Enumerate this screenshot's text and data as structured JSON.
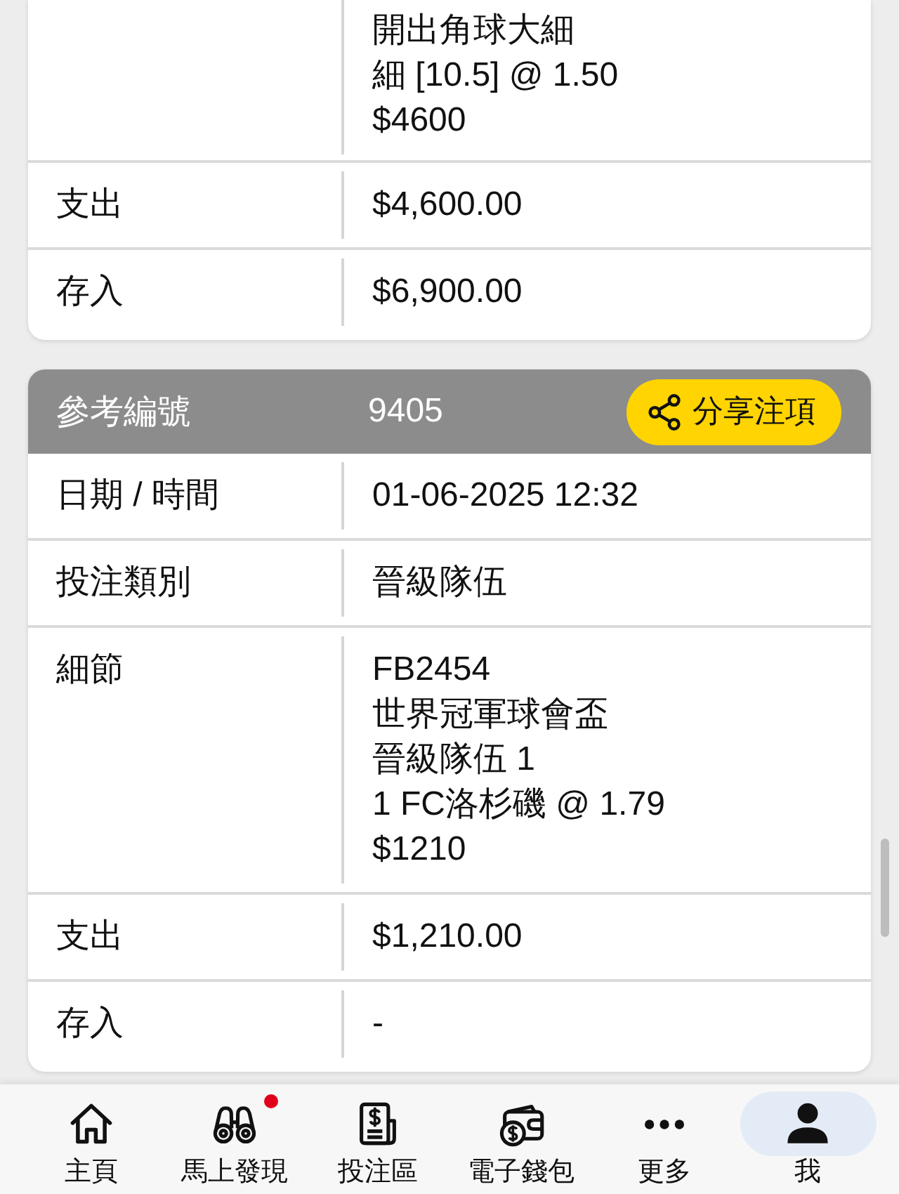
{
  "cards": [
    {
      "rows": [
        {
          "kind": "lines",
          "lines": [
            "開出角球大細",
            "細 [10.5] @ 1.50",
            "$4600"
          ]
        },
        {
          "kind": "text",
          "label": "支出",
          "value": "$4,600.00"
        },
        {
          "kind": "text",
          "label": "存入",
          "value": "$6,900.00"
        }
      ]
    },
    {
      "header": {
        "label": "參考編號",
        "value": "9405",
        "share_button": "分享注項"
      },
      "rows": [
        {
          "kind": "text",
          "label": "日期 / 時間",
          "value": "01-06-2025 12:32"
        },
        {
          "kind": "text",
          "label": "投注類別",
          "value": "晉級隊伍"
        },
        {
          "kind": "lines",
          "label": "細節",
          "lines": [
            "FB2454",
            "世界冠軍球會盃",
            "晉級隊伍 1",
            "1 FC洛杉磯 @ 1.79",
            "$1210"
          ]
        },
        {
          "kind": "text",
          "label": "支出",
          "value": "$1,210.00"
        },
        {
          "kind": "text",
          "label": "存入",
          "value": "-"
        }
      ]
    }
  ],
  "bottom_nav": [
    {
      "label": "主頁",
      "selected": false,
      "notification": false
    },
    {
      "label": "馬上發現",
      "selected": false,
      "notification": true
    },
    {
      "label": "投注區",
      "selected": false,
      "notification": false
    },
    {
      "label": "電子錢包",
      "selected": false,
      "notification": false
    },
    {
      "label": "更多",
      "selected": false,
      "notification": false
    },
    {
      "label": "我",
      "selected": true,
      "notification": false
    }
  ]
}
